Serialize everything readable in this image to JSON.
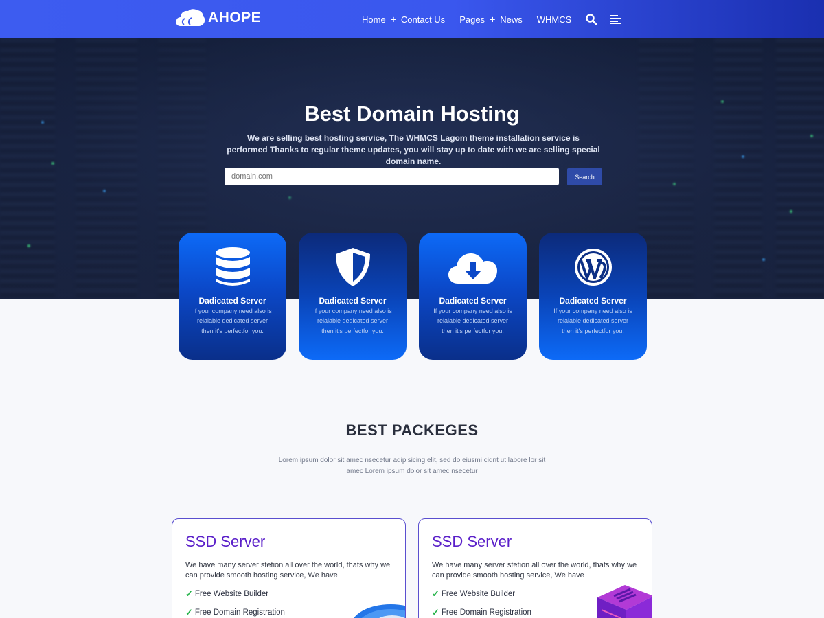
{
  "header": {
    "logo_text": "AHOPE",
    "nav": [
      {
        "label": "Home",
        "plus": "+"
      },
      {
        "label": "Contact Us"
      },
      {
        "label": "Pages",
        "plus": "+"
      },
      {
        "label": "News"
      },
      {
        "label": "WHMCS"
      }
    ],
    "icons": [
      "search-icon",
      "menu-icon"
    ]
  },
  "hero": {
    "title": "Best Domain Hosting",
    "subtitle": "We are selling best hosting service, The WHMCS Lagom theme installation service is performed Thanks to regular theme updates, you will stay up to date with we are selling special domain name.",
    "search_placeholder": "domain.com",
    "search_button": "Search"
  },
  "features": [
    {
      "icon": "database-icon",
      "title": "Dadicated Server",
      "text": "If your company need also is relaiable dedicated server then it's perfectfor you."
    },
    {
      "icon": "shield-icon",
      "title": "Dadicated Server",
      "text": "If your company need also is relaiable dedicated server then it's perfectfor you."
    },
    {
      "icon": "cloud-download-icon",
      "title": "Dadicated Server",
      "text": "If your company need also is relaiable dedicated server then it's perfectfor you."
    },
    {
      "icon": "wordpress-icon",
      "title": "Dadicated Server",
      "text": "If your company need also is relaiable dedicated server then it's perfectfor you."
    }
  ],
  "packages": {
    "title": "BEST PACKEGES",
    "subtitle": "Lorem ipsum dolor sit amec nsecetur adipisicing elit, sed do eiusmi cidnt ut labore lor sit amec Lorem ipsum dolor sit amec nsecetur",
    "cards": [
      {
        "title": "SSD Server",
        "text": "We have many server stetion all over the world, thats why we can provide smooth hosting service, We have",
        "features": [
          "Free Website Builder",
          "Free Domain Registration"
        ]
      },
      {
        "title": "SSD Server",
        "text": "We have many server stetion all over the world, thats why we can provide smooth hosting service, We have",
        "features": [
          "Free Website Builder",
          "Free Domain Registration"
        ]
      }
    ]
  },
  "colors": {
    "header": "#3d5cf0",
    "card_blue": "#0d6af7",
    "card_navy": "#0a2f8a",
    "package_title": "#5a1fc9",
    "check": "#25b34a"
  }
}
